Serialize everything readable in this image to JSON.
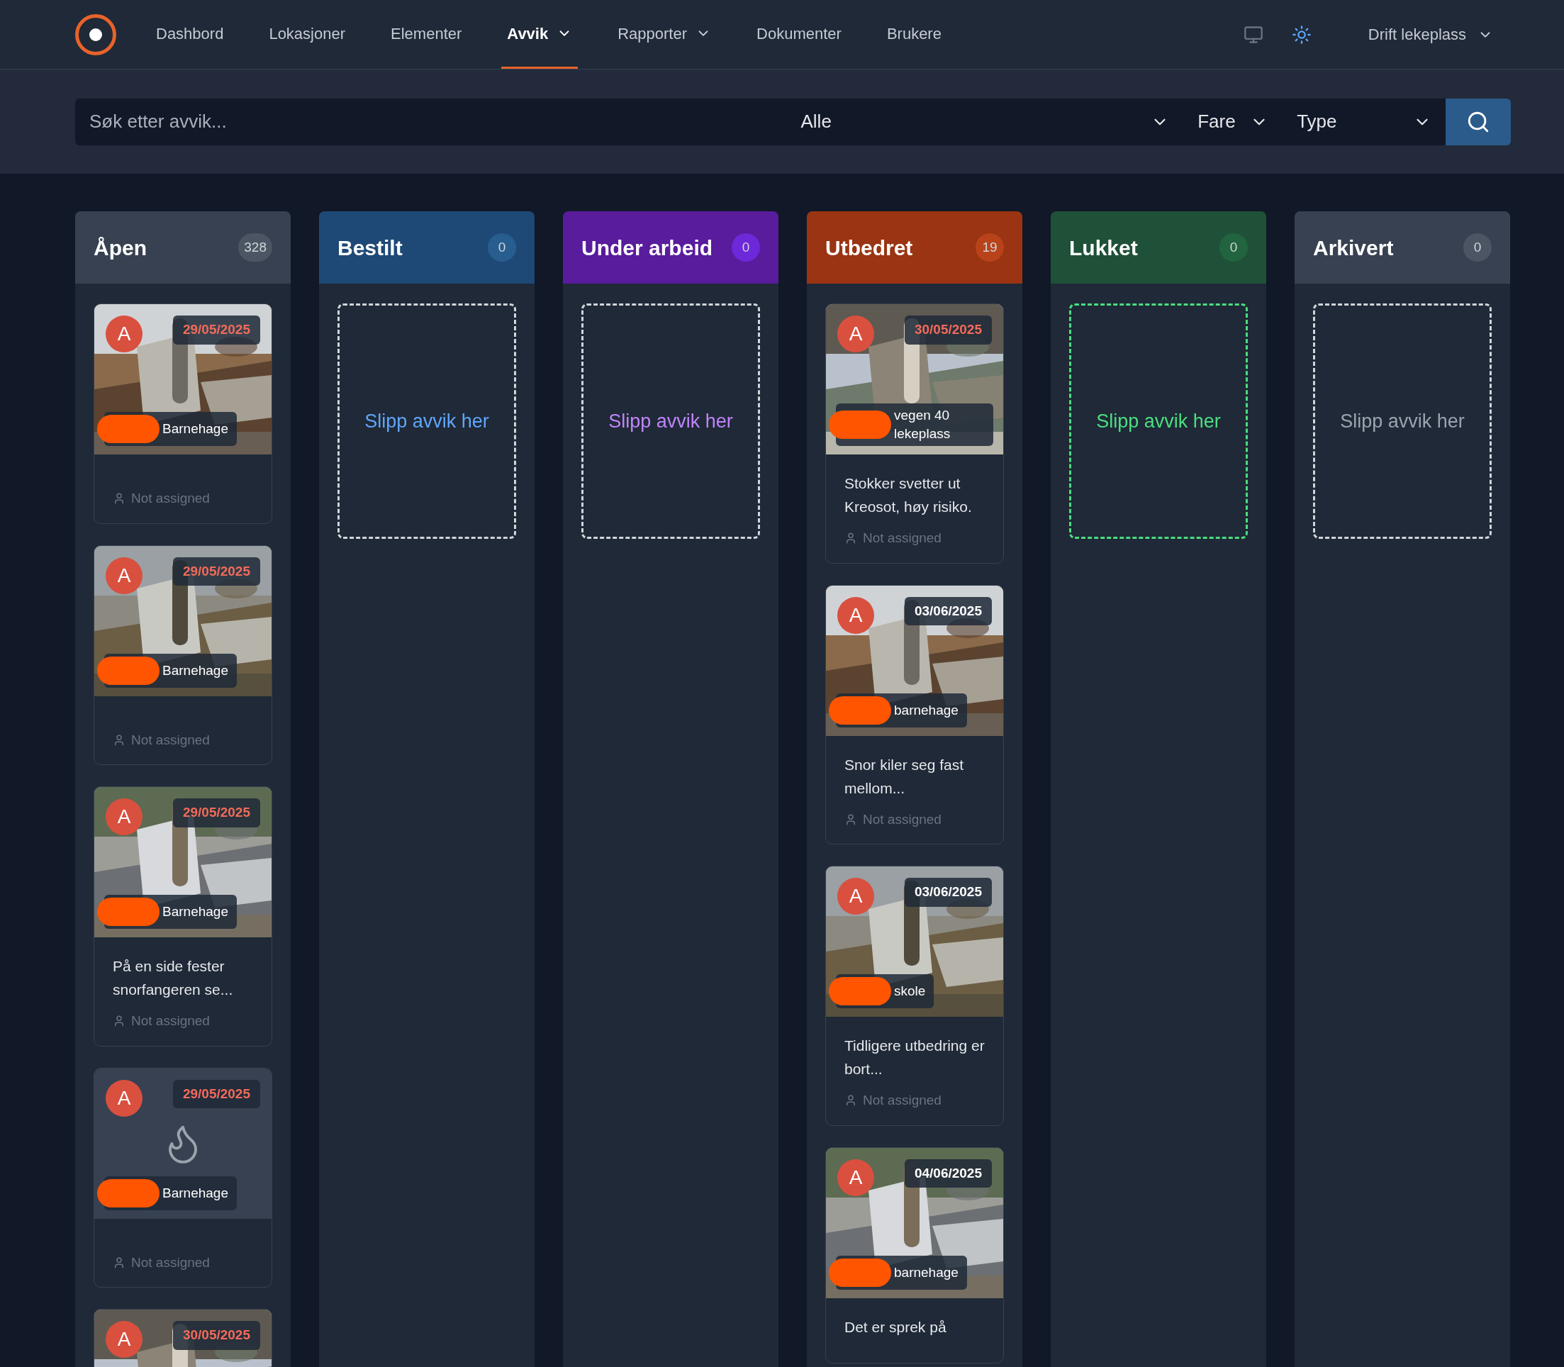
{
  "nav": {
    "items": [
      {
        "label": "Dashbord",
        "selected": false,
        "has_menu": false
      },
      {
        "label": "Lokasjoner",
        "selected": false,
        "has_menu": false
      },
      {
        "label": "Elementer",
        "selected": false,
        "has_menu": false
      },
      {
        "label": "Avvik",
        "selected": true,
        "has_menu": true
      },
      {
        "label": "Rapporter",
        "selected": false,
        "has_menu": true
      },
      {
        "label": "Dokumenter",
        "selected": false,
        "has_menu": false
      },
      {
        "label": "Brukere",
        "selected": false,
        "has_menu": false
      }
    ],
    "user": "Drift lekeplass"
  },
  "search": {
    "placeholder": "Søk etter avvik...",
    "filters": [
      "Alle",
      "Fare",
      "Type"
    ]
  },
  "columns": [
    {
      "title": "Åpen",
      "color": "#374151",
      "badge": {
        "count": "328",
        "color": "#4b5563"
      },
      "cards": [
        {
          "avatar": "A",
          "date": "29/05/2025",
          "overdue": true,
          "location": "Barnehage",
          "assignee": "Not assigned"
        },
        {
          "avatar": "A",
          "date": "29/05/2025",
          "overdue": true,
          "location": "Barnehage",
          "assignee": "Not assigned"
        },
        {
          "avatar": "A",
          "date": "29/05/2025",
          "overdue": true,
          "location": "Barnehage",
          "description": "På en side fester snorfangeren se...",
          "assignee": "Not assigned"
        },
        {
          "kind": "no_image",
          "avatar": "A",
          "date": "29/05/2025",
          "overdue": true,
          "location": "Barnehage",
          "assignee": "Not assigned"
        },
        {
          "avatar": "A",
          "date": "30/05/2025",
          "overdue": true
        }
      ]
    },
    {
      "title": "Bestilt",
      "color": "#1e4976",
      "badge": {
        "count": "0",
        "color": "#285d8f"
      },
      "dropzone": {
        "label": "Slipp avvik her",
        "color": "#60a5fa"
      }
    },
    {
      "title": "Under arbeid",
      "color": "#581c9c",
      "badge": {
        "count": "0",
        "color": "#6d28d9"
      },
      "dropzone": {
        "label": "Slipp avvik her",
        "color": "#c084fc"
      }
    },
    {
      "title": "Utbedret",
      "color": "#9a3412",
      "badge": {
        "count": "19",
        "color": "#b8431a"
      },
      "cards": [
        {
          "avatar": "A",
          "date": "30/05/2025",
          "overdue": true,
          "location": "vegen 40 lekeplass",
          "description": "Stokker svetter ut Kreosot, høy risiko.",
          "assignee": "Not assigned"
        },
        {
          "avatar": "A",
          "date": "03/06/2025",
          "overdue": false,
          "location": "barnehage",
          "description": "Snor kiler seg fast mellom...",
          "assignee": "Not assigned"
        },
        {
          "avatar": "A",
          "date": "03/06/2025",
          "overdue": false,
          "location": "skole",
          "description": "Tidligere utbedring er bort...",
          "assignee": "Not assigned"
        },
        {
          "avatar": "A",
          "date": "04/06/2025",
          "overdue": false,
          "location": "barnehage",
          "description": "Det er sprek på"
        }
      ]
    },
    {
      "title": "Lukket",
      "color": "#1f5138",
      "badge": {
        "count": "0",
        "color": "#22643f"
      },
      "dropzone": {
        "label": "Slipp avvik her",
        "color": "#4ade80"
      }
    },
    {
      "title": "Arkivert",
      "color": "#374151",
      "badge": {
        "count": "0",
        "color": "#4b5563"
      },
      "dropzone": {
        "label": "Slipp avvik her",
        "color": "#9ca3af"
      }
    }
  ]
}
